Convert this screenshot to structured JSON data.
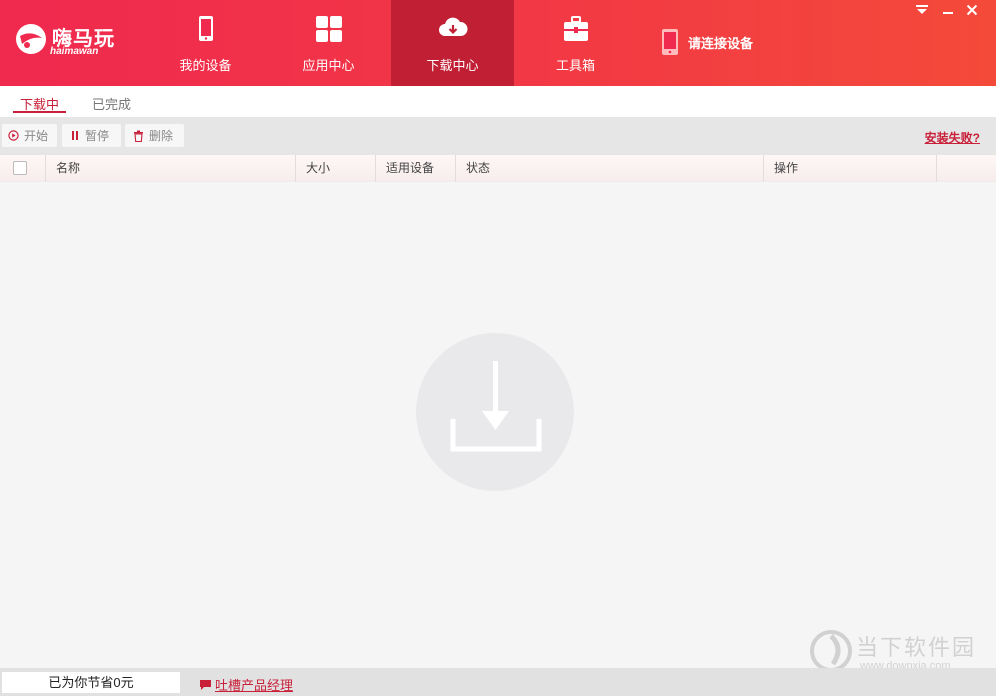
{
  "app": {
    "logo_text": "嗨马玩",
    "logo_sub": "haimawan"
  },
  "nav": {
    "items": [
      {
        "label": "我的设备",
        "icon": "phone-icon",
        "active": false
      },
      {
        "label": "应用中心",
        "icon": "grid-icon",
        "active": false
      },
      {
        "label": "下载中心",
        "icon": "cloud-download-icon",
        "active": true
      },
      {
        "label": "工具箱",
        "icon": "toolbox-icon",
        "active": false
      }
    ],
    "device_prompt": "请连接设备"
  },
  "subtabs": {
    "downloading": "下载中",
    "completed": "已完成"
  },
  "toolbar": {
    "start": "开始",
    "pause": "暂停",
    "delete": "删除",
    "help": "安装失败?"
  },
  "table": {
    "columns": [
      "名称",
      "大小",
      "适用设备",
      "状态",
      "操作"
    ]
  },
  "footer": {
    "saved": "已为你节省0元",
    "feedback": "吐槽产品经理"
  },
  "watermark": {
    "cn": "当下软件园",
    "url": "www.downxia.com"
  },
  "colors": {
    "brand": "#f0294f",
    "active_nav": "#c11f34",
    "accent": "#c9203a"
  }
}
